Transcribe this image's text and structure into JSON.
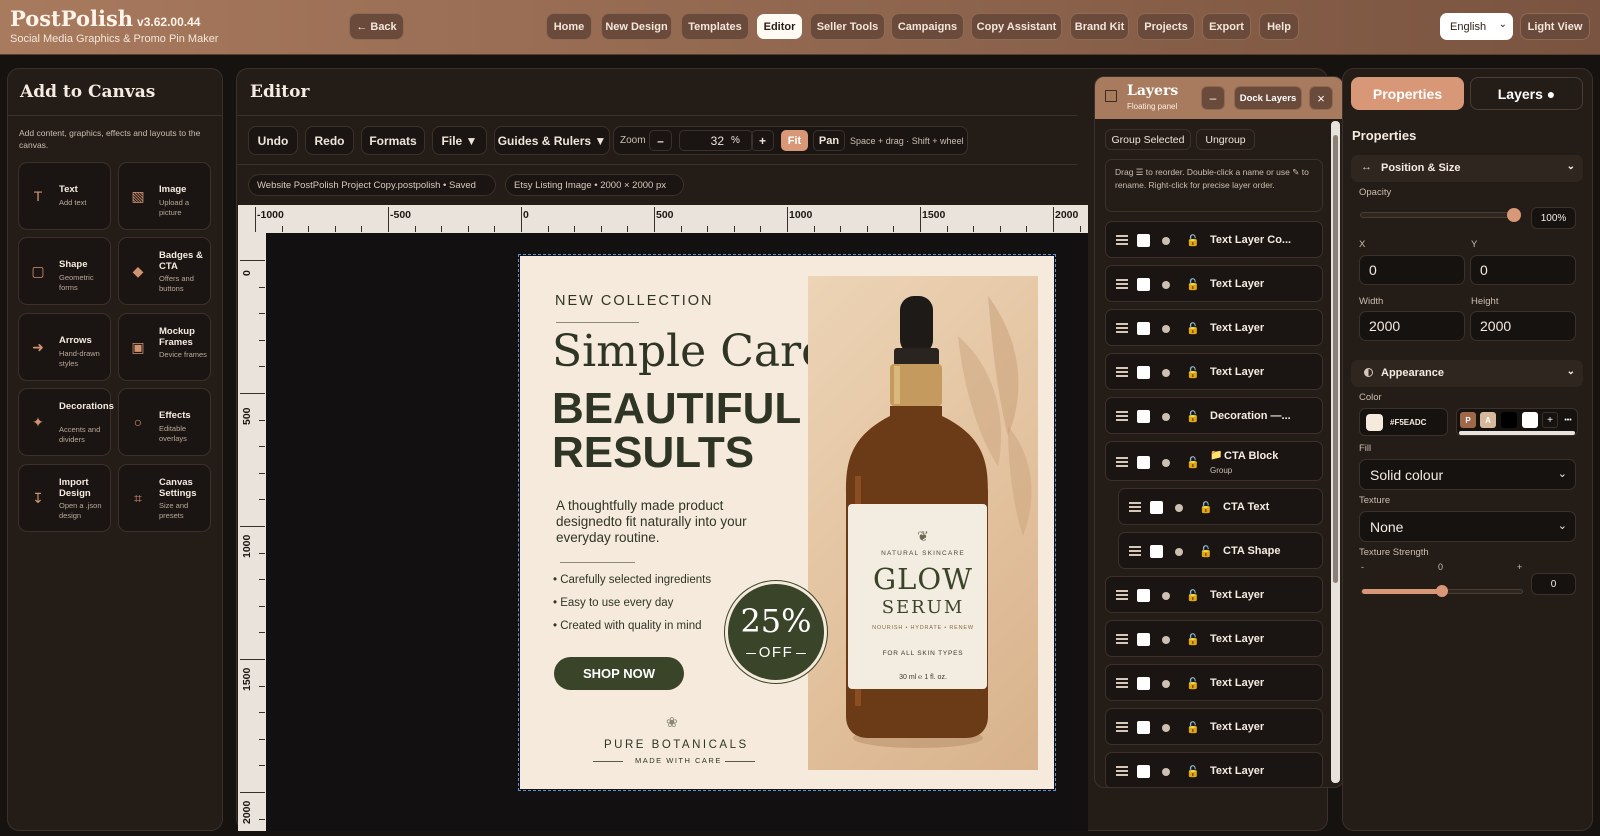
{
  "app": {
    "name": "PostPolish",
    "version": "v3.62.00.44",
    "subtitle": "Social Media Graphics & Promo Pin Maker"
  },
  "topbar": {
    "back": "← Back",
    "nav": [
      "Home",
      "New Design",
      "Templates",
      "Editor",
      "Seller Tools",
      "Campaigns",
      "Copy Assistant",
      "Brand Kit",
      "Projects",
      "Export",
      "Help"
    ],
    "active_nav": "Editor",
    "language": "English",
    "view_toggle": "Light View"
  },
  "left_panel": {
    "title": "Add to Canvas",
    "description": "Add content, graphics, effects and layouts to the canvas.",
    "tiles": [
      {
        "title": "Text",
        "sub": "Add text",
        "icon": "text-icon"
      },
      {
        "title": "Image",
        "sub": "Upload a picture",
        "icon": "image-icon"
      },
      {
        "title": "Shape",
        "sub": "Geometric forms",
        "icon": "square-icon"
      },
      {
        "title": "Badges & CTA",
        "sub": "Offers and buttons",
        "icon": "diamond-icon"
      },
      {
        "title": "Arrows",
        "sub": "Hand-drawn styles",
        "icon": "arrow-icon"
      },
      {
        "title": "Mockup Frames",
        "sub": "Device frames",
        "icon": "frame-icon"
      },
      {
        "title": "Decorations",
        "sub": "Accents and dividers",
        "icon": "sparkle-icon"
      },
      {
        "title": "Effects",
        "sub": "Editable overlays",
        "icon": "circle-icon"
      },
      {
        "title": "Import Design",
        "sub": "Open a .json design",
        "icon": "import-icon"
      },
      {
        "title": "Canvas Settings",
        "sub": "Size and presets",
        "icon": "crop-icon"
      }
    ]
  },
  "editor": {
    "title": "Editor",
    "toolbar": {
      "undo": "Undo",
      "redo": "Redo",
      "formats": "Formats",
      "file": "File ▼",
      "guides": "Guides & Rulers ▼",
      "zoom_label": "Zoom",
      "zoom_minus": "–",
      "zoom_value": "32",
      "zoom_unit": "%",
      "zoom_plus": "+",
      "fit": "Fit",
      "pan": "Pan",
      "hint": "Space + drag · Shift + wheel"
    },
    "project_chip": "Website PostPolish Project Copy.postpolish • Saved",
    "format_chip": "Etsy Listing Image • 2000 × 2000 px",
    "ruler_h": [
      "-1000",
      "-500",
      "0",
      "500",
      "1000",
      "1500",
      "2000"
    ],
    "ruler_v": [
      "0",
      "500",
      "1000",
      "1500",
      "2000"
    ]
  },
  "canvas": {
    "kicker": "NEW COLLECTION",
    "script_title": "Simple Care",
    "headline1": "BEAUTIFUL",
    "headline2": "RESULTS",
    "body": "A thoughtfully made product designedto fit naturally into your everyday routine.",
    "bullets": [
      "• Carefully selected ingredients",
      "• Easy to use every day",
      "• Created with quality in mind"
    ],
    "badge_big": "25%",
    "badge_small": "OFF",
    "cta": "SHOP NOW",
    "footer": "PURE BOTANICALS",
    "footer_sub": "MADE WITH CARE",
    "label": {
      "top": "NATURAL SKINCARE",
      "glow": "GLOW",
      "serum": "SERUM",
      "benefits": "NOURISH • HYDRATE • RENEW",
      "skin": "FOR ALL SKIN TYPES",
      "size": "30 ml ℮ 1 fl. oz."
    },
    "colors": {
      "background": "#F5EADC",
      "dark_green": "#3A4429",
      "beige_panel": "#E8CDAF",
      "amber": "#6B3A17",
      "gold": "#C7A066"
    }
  },
  "layers_panel": {
    "title": "Layers",
    "subtitle": "Floating panel",
    "minimize": "–",
    "dock": "Dock Layers",
    "close": "×",
    "group_selected": "Group Selected",
    "ungroup": "Ungroup",
    "hint": "Drag ☰ to reorder. Double-click a name or use ✎ to rename. Right-click for precise layer order.",
    "rows": [
      {
        "name": "Text Layer Co...",
        "indent": false
      },
      {
        "name": "Text Layer",
        "indent": false
      },
      {
        "name": "Text Layer",
        "indent": false
      },
      {
        "name": "Text Layer",
        "indent": false
      },
      {
        "name": "Decoration —...",
        "indent": false
      },
      {
        "name": "CTA Block",
        "sub": "Group",
        "indent": false
      },
      {
        "name": "CTA Text",
        "indent": true
      },
      {
        "name": "CTA Shape",
        "indent": true
      },
      {
        "name": "Text Layer",
        "indent": false
      },
      {
        "name": "Text Layer",
        "indent": false
      },
      {
        "name": "Text Layer",
        "indent": false
      },
      {
        "name": "Text Layer",
        "indent": false
      },
      {
        "name": "Text Layer",
        "indent": false
      }
    ]
  },
  "right_panel": {
    "tab_properties": "Properties",
    "tab_layers": "Layers ●",
    "heading": "Properties",
    "position_section": "Position & Size",
    "opacity_label": "Opacity",
    "opacity_value": "100%",
    "opacity": 1.0,
    "x_label": "X",
    "x_value": "0",
    "y_label": "Y",
    "y_value": "0",
    "width_label": "Width",
    "width_value": "2000",
    "height_label": "Height",
    "height_value": "2000",
    "appearance_section": "Appearance",
    "color_label": "Color",
    "color_value": "#F5EADC",
    "color_hex_text": "#F5EADC",
    "swatch_p": "P",
    "swatch_a": "A",
    "swatch_plus": "+",
    "swatch_more": "•••",
    "fill_label": "Fill",
    "fill_value": "Solid colour",
    "texture_label": "Texture",
    "texture_value": "None",
    "texture_strength_label": "Texture Strength",
    "ts_min": "-",
    "ts_mid": "0",
    "ts_max": "+",
    "ts_value": "0"
  }
}
